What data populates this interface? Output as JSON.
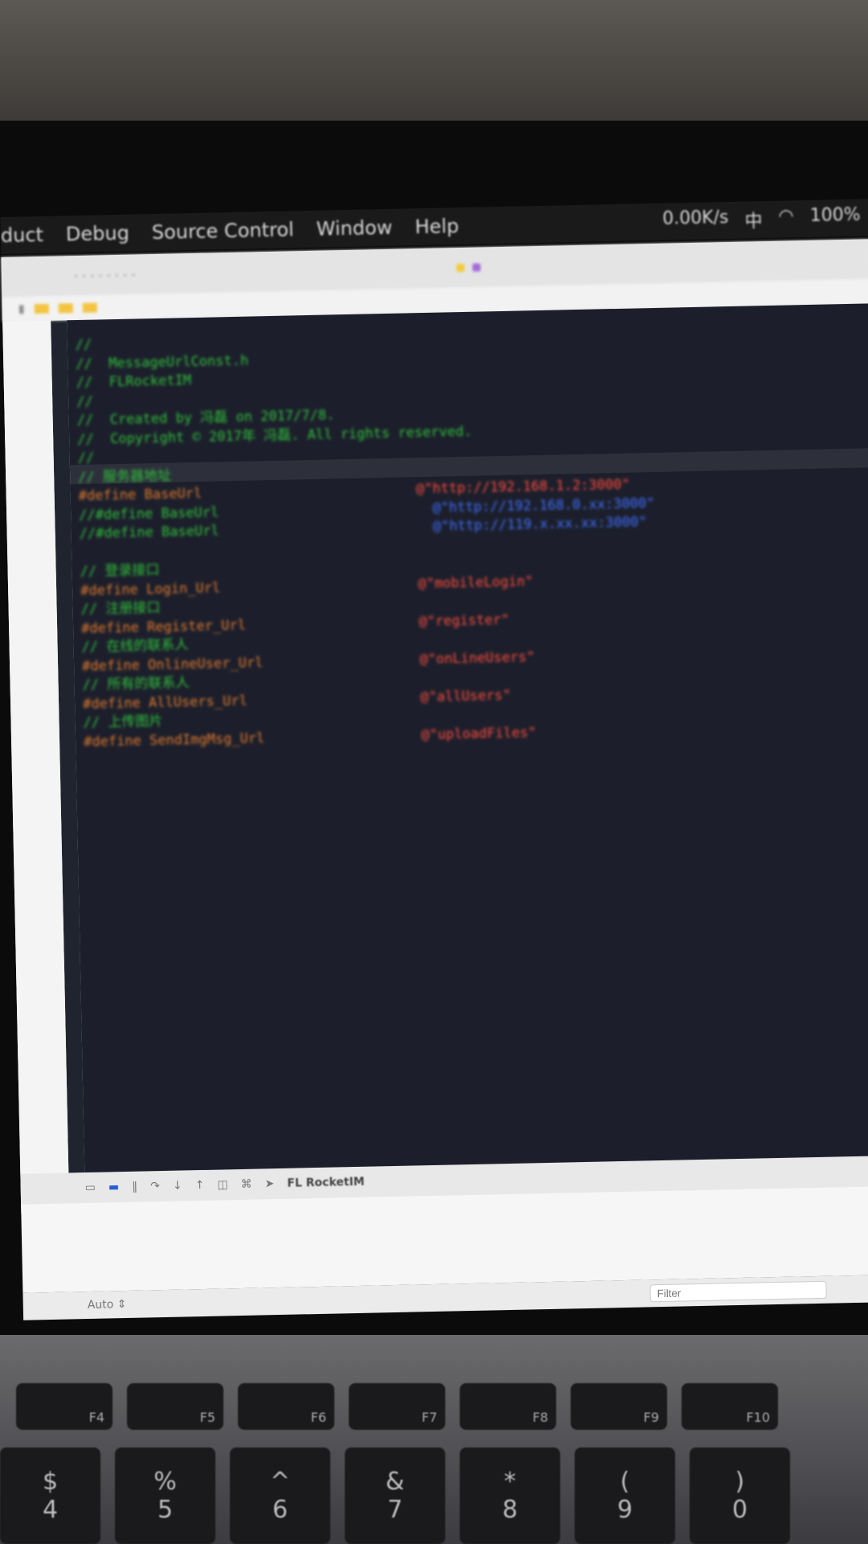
{
  "menubar": {
    "items": [
      "duct",
      "Debug",
      "Source Control",
      "Window",
      "Help"
    ],
    "status": [
      "0.00K/s",
      "中",
      "100%"
    ]
  },
  "window": {
    "target": "FL RocketIM",
    "filter_placeholder": "Filter",
    "status_left": "Auto ⇕"
  },
  "code": {
    "header": [
      "//",
      "//  MessageUrlConst.h",
      "//  FLRocketIM",
      "//",
      "//  Created by 冯磊 on 2017/7/8.",
      "//  Copyright © 2017年 冯磊. All rights reserved.",
      "//"
    ],
    "lines": [
      {
        "left": "// 服务器地址",
        "cls": "cm",
        "right": "",
        "rcls": ""
      },
      {
        "left": "#define BaseUrl",
        "cls": "pp",
        "right": "@\"http://192.168.1.2:3000\"",
        "rcls": "str"
      },
      {
        "left": "//#define BaseUrl",
        "cls": "cm",
        "right": "@\"http://192.168.0.xx:3000\"",
        "rcls": "url"
      },
      {
        "left": "//#define BaseUrl",
        "cls": "cm",
        "right": "@\"http://119.x.xx.xx:3000\"",
        "rcls": "url"
      },
      {
        "left": "",
        "cls": "",
        "right": "",
        "rcls": ""
      },
      {
        "left": "// 登录接口",
        "cls": "cm",
        "right": "",
        "rcls": ""
      },
      {
        "left": "#define Login_Url",
        "cls": "pp",
        "right": "@\"mobileLogin\"",
        "rcls": "str"
      },
      {
        "left": "// 注册接口",
        "cls": "cm",
        "right": "",
        "rcls": ""
      },
      {
        "left": "#define Register_Url",
        "cls": "pp",
        "right": "@\"register\"",
        "rcls": "str"
      },
      {
        "left": "// 在线的联系人",
        "cls": "cm",
        "right": "",
        "rcls": ""
      },
      {
        "left": "#define OnlineUser_Url",
        "cls": "pp",
        "right": "@\"onLineUsers\"",
        "rcls": "str"
      },
      {
        "left": "// 所有的联系人",
        "cls": "cm",
        "right": "",
        "rcls": ""
      },
      {
        "left": "#define AllUsers_Url",
        "cls": "pp",
        "right": "@\"allUsers\"",
        "rcls": "str"
      },
      {
        "left": "// 上传图片",
        "cls": "cm",
        "right": "",
        "rcls": ""
      },
      {
        "left": "#define SendImgMsg_Url",
        "cls": "pp",
        "right": "@\"uploadFiles\"",
        "rcls": "str"
      }
    ]
  },
  "keyboard": {
    "fkeys": [
      "F4",
      "F5",
      "F6",
      "F7",
      "F8",
      "F9",
      "F10"
    ],
    "numkeys": [
      [
        "$",
        "4"
      ],
      [
        "%",
        "5"
      ],
      [
        "^",
        "6"
      ],
      [
        "&",
        "7"
      ],
      [
        "*",
        "8"
      ],
      [
        "(",
        "9"
      ],
      [
        ")",
        "0"
      ]
    ]
  },
  "colors": {
    "editor_bg": "#1c1f2b",
    "comment": "#2fbf3a",
    "preprocessor": "#e0782c",
    "string": "#ff4a3b",
    "url_string": "#3d6dff"
  }
}
